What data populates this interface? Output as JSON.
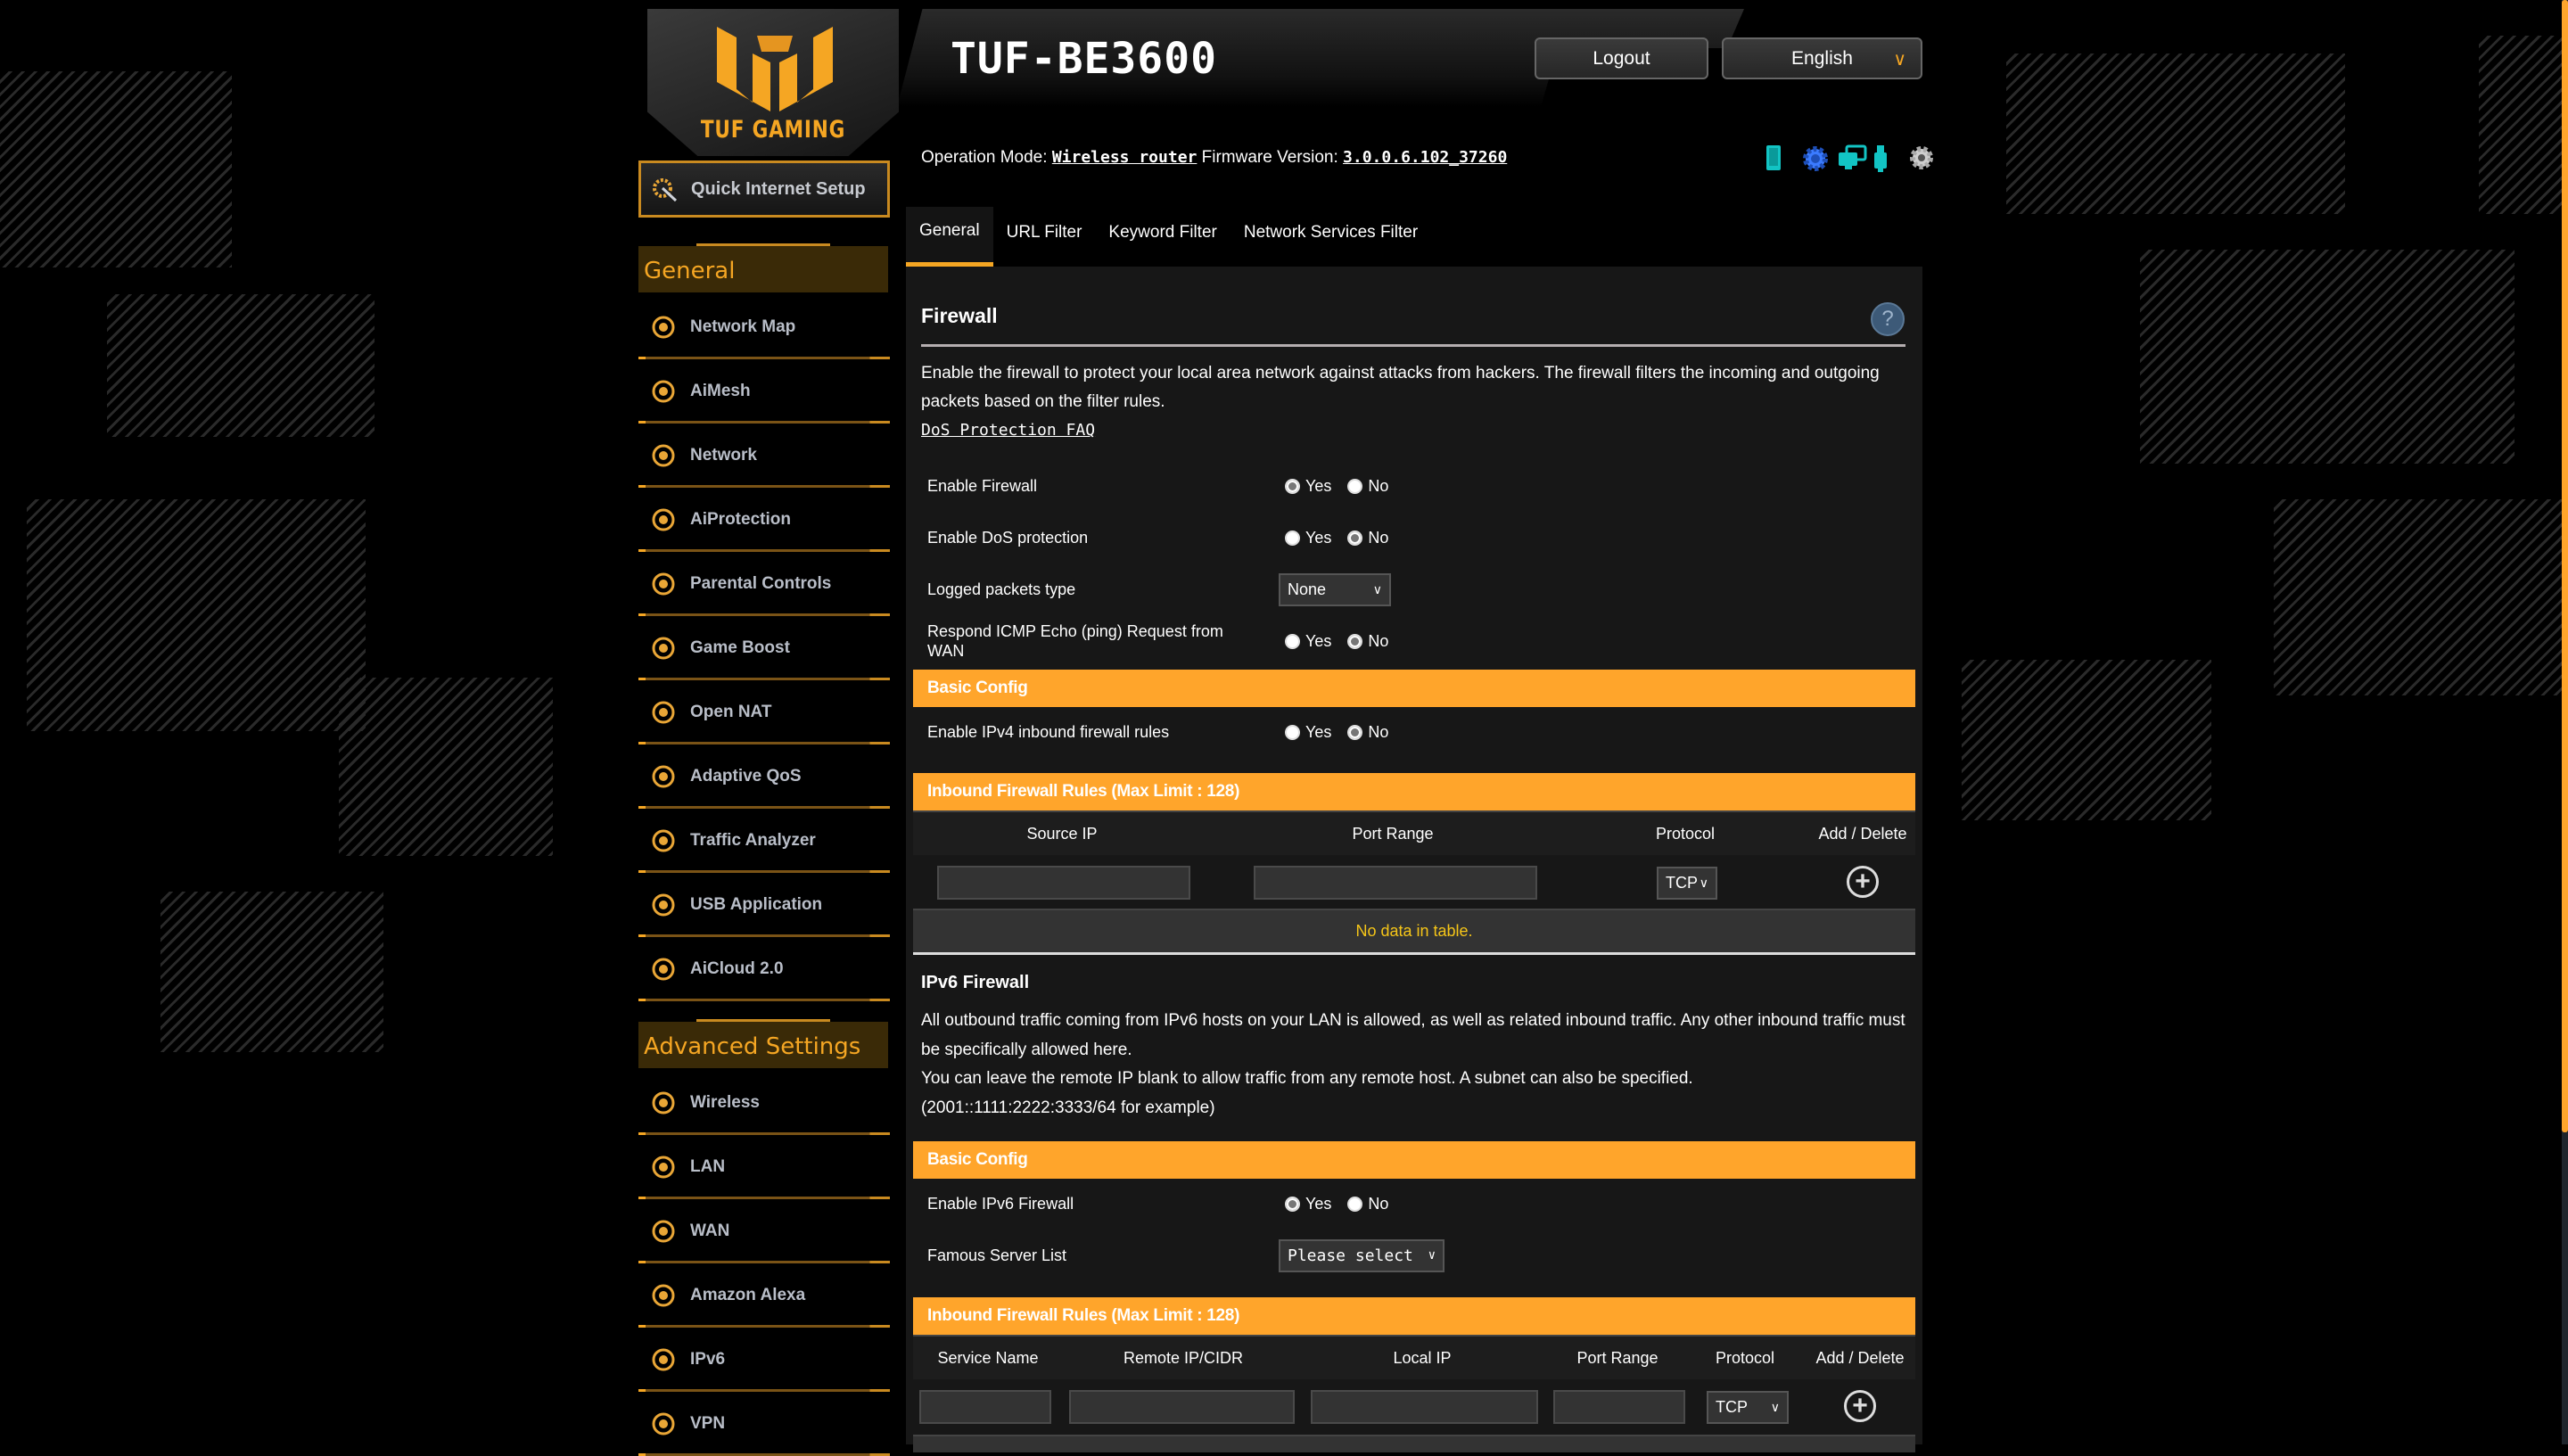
{
  "header": {
    "brand": "TUF GAMING",
    "model": "TUF-BE3600",
    "logout_label": "Logout",
    "language": "English",
    "op_mode_label": "Operation Mode:",
    "op_mode_value": "Wireless router",
    "firmware_label": "Firmware Version:",
    "firmware_value": "3.0.0.6.102_37260",
    "status_icons": [
      "phone-icon",
      "gear-icon",
      "monitors-icon",
      "usb-icon",
      "refresh-gear-icon"
    ]
  },
  "sidebar": {
    "quick_setup": "Quick Internet Setup",
    "general_title": "General",
    "general_items": [
      {
        "label": "Network Map",
        "icon": "globe-pin-icon"
      },
      {
        "label": "AiMesh",
        "icon": "aimesh-icon"
      },
      {
        "label": "Network",
        "icon": "globe-users-icon"
      },
      {
        "label": "AiProtection",
        "icon": "shield-lock-icon"
      },
      {
        "label": "Parental Controls",
        "icon": "family-icon"
      },
      {
        "label": "Game Boost",
        "icon": "rocket-icon"
      },
      {
        "label": "Open NAT",
        "icon": "server-gamepad-icon"
      },
      {
        "label": "Adaptive QoS",
        "icon": "speedometer-icon"
      },
      {
        "label": "Traffic Analyzer",
        "icon": "globe-chart-icon"
      },
      {
        "label": "USB Application",
        "icon": "usb-drive-icon"
      },
      {
        "label": "AiCloud 2.0",
        "icon": "cloud-icon"
      }
    ],
    "advanced_title": "Advanced Settings",
    "advanced_items": [
      {
        "label": "Wireless",
        "icon": "wifi-icon"
      },
      {
        "label": "LAN",
        "icon": "ethernet-port-icon"
      },
      {
        "label": "WAN",
        "icon": "globe-icon"
      },
      {
        "label": "Amazon Alexa",
        "icon": "alexa-icon"
      },
      {
        "label": "IPv6",
        "icon": "ipv6-icon"
      },
      {
        "label": "VPN",
        "icon": "vpn-monitor-icon"
      }
    ]
  },
  "tabs": [
    {
      "label": "General",
      "active": true
    },
    {
      "label": "URL Filter",
      "active": false
    },
    {
      "label": "Keyword Filter",
      "active": false
    },
    {
      "label": "Network Services Filter",
      "active": false
    }
  ],
  "firewall": {
    "title": "Firewall",
    "description": "Enable the firewall to protect your local area network against attacks from hackers. The firewall filters the incoming and outgoing packets based on the filter rules.",
    "faq_link": "DoS Protection FAQ",
    "yes": "Yes",
    "no": "No",
    "enable_firewall": {
      "label": "Enable Firewall",
      "value": "Yes"
    },
    "enable_dos": {
      "label": "Enable DoS protection",
      "value": "No"
    },
    "logged_packets": {
      "label": "Logged packets type",
      "value": "None"
    },
    "icmp": {
      "label": "Respond ICMP Echo (ping) Request from WAN",
      "value": "No"
    },
    "basic_config_title": "Basic Config",
    "ipv4_inbound": {
      "label": "Enable IPv4 inbound firewall rules",
      "value": "No"
    },
    "rules_title": "Inbound Firewall Rules (Max Limit : 128)",
    "rules_columns": [
      "Source IP",
      "Port Range",
      "Protocol",
      "Add / Delete"
    ],
    "rules_new_row": {
      "source_ip": "",
      "port_range": "",
      "protocol": "TCP"
    },
    "rules_empty": "No data in table."
  },
  "ipv6": {
    "title": "IPv6 Firewall",
    "desc1": "All outbound traffic coming from IPv6 hosts on your LAN is allowed, as well as related inbound traffic. Any other inbound traffic must be specifically allowed here.",
    "desc2": "You can leave the remote IP blank to allow traffic from any remote host. A subnet can also be specified.",
    "desc3": "(2001::1111:2222:3333/64 for example)",
    "basic_config_title": "Basic Config",
    "enable": {
      "label": "Enable IPv6 Firewall",
      "value": "Yes"
    },
    "famous_server": {
      "label": "Famous Server List",
      "value": "Please select"
    },
    "rules_title": "Inbound Firewall Rules (Max Limit : 128)",
    "rules_columns": [
      "Service Name",
      "Remote IP/CIDR",
      "Local IP",
      "Port Range",
      "Protocol",
      "Add / Delete"
    ],
    "rules_new_row": {
      "service_name": "",
      "remote_ip": "",
      "local_ip": "",
      "port_range": "",
      "protocol": "TCP"
    }
  },
  "colors": {
    "accent": "#ffa52b",
    "brand": "#f5a623",
    "panel": "#181818",
    "nodata_text": "#f5c518"
  }
}
